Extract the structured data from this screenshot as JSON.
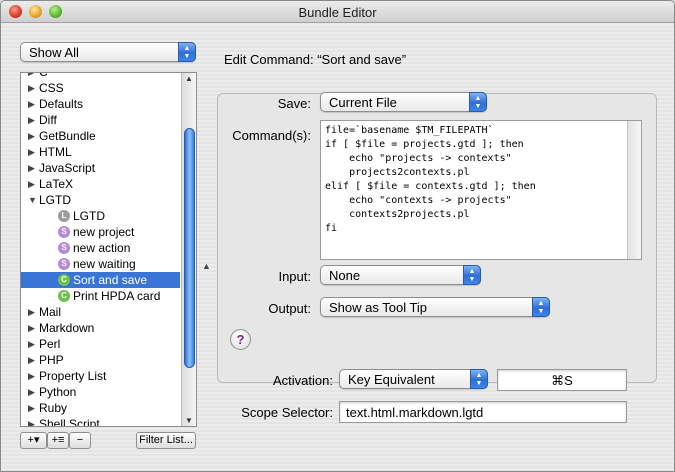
{
  "window": {
    "title": "Bundle Editor"
  },
  "sidebar": {
    "filter_popup": "Show All",
    "items": [
      {
        "label": "C",
        "kind": "bundle",
        "expanded": false
      },
      {
        "label": "CSS",
        "kind": "bundle",
        "expanded": false
      },
      {
        "label": "Defaults",
        "kind": "bundle",
        "expanded": false
      },
      {
        "label": "Diff",
        "kind": "bundle",
        "expanded": false
      },
      {
        "label": "GetBundle",
        "kind": "bundle",
        "expanded": false
      },
      {
        "label": "HTML",
        "kind": "bundle",
        "expanded": false
      },
      {
        "label": "JavaScript",
        "kind": "bundle",
        "expanded": false
      },
      {
        "label": "LaTeX",
        "kind": "bundle",
        "expanded": false
      },
      {
        "label": "LGTD",
        "kind": "bundle",
        "expanded": true
      },
      {
        "label": "LGTD",
        "kind": "language",
        "badge": "L"
      },
      {
        "label": "new project",
        "kind": "snippet",
        "badge": "S"
      },
      {
        "label": "new action",
        "kind": "snippet",
        "badge": "S"
      },
      {
        "label": "new waiting",
        "kind": "snippet",
        "badge": "S"
      },
      {
        "label": "Sort and save",
        "kind": "command",
        "badge": "C",
        "selected": true
      },
      {
        "label": "Print HPDA card",
        "kind": "command",
        "badge": "C"
      },
      {
        "label": "Mail",
        "kind": "bundle",
        "expanded": false
      },
      {
        "label": "Markdown",
        "kind": "bundle",
        "expanded": false
      },
      {
        "label": "Perl",
        "kind": "bundle",
        "expanded": false
      },
      {
        "label": "PHP",
        "kind": "bundle",
        "expanded": false
      },
      {
        "label": "Property List",
        "kind": "bundle",
        "expanded": false
      },
      {
        "label": "Python",
        "kind": "bundle",
        "expanded": false
      },
      {
        "label": "Ruby",
        "kind": "bundle",
        "expanded": false
      },
      {
        "label": "Shell Script",
        "kind": "bundle",
        "expanded": false
      }
    ],
    "add_button": "+▾",
    "add_item_button": "+≡",
    "remove_button": "−",
    "filter_list_button": "Filter List..."
  },
  "editor": {
    "heading": "Edit Command: “Sort and save”",
    "save_label": "Save:",
    "save_value": "Current File",
    "command_label": "Command(s):",
    "command_text": "file=`basename $TM_FILEPATH`\nif [ $file = projects.gtd ]; then\n    echo \"projects -> contexts\"\n    projects2contexts.pl\nelif [ $file = contexts.gtd ]; then\n    echo \"contexts -> projects\"\n    contexts2projects.pl\nfi",
    "input_label": "Input:",
    "input_value": "None",
    "output_label": "Output:",
    "output_value": "Show as Tool Tip",
    "help_button": "?",
    "activation_label": "Activation:",
    "activation_value": "Key Equivalent",
    "key_equivalent": "⌘S",
    "scope_label": "Scope Selector:",
    "scope_value": "text.html.markdown.lgtd"
  },
  "colors": {
    "selection": "#3875d7",
    "snippet_badge": "#b38be0",
    "language_badge": "#9c9c9c",
    "command_badge": "#6cc24a"
  }
}
